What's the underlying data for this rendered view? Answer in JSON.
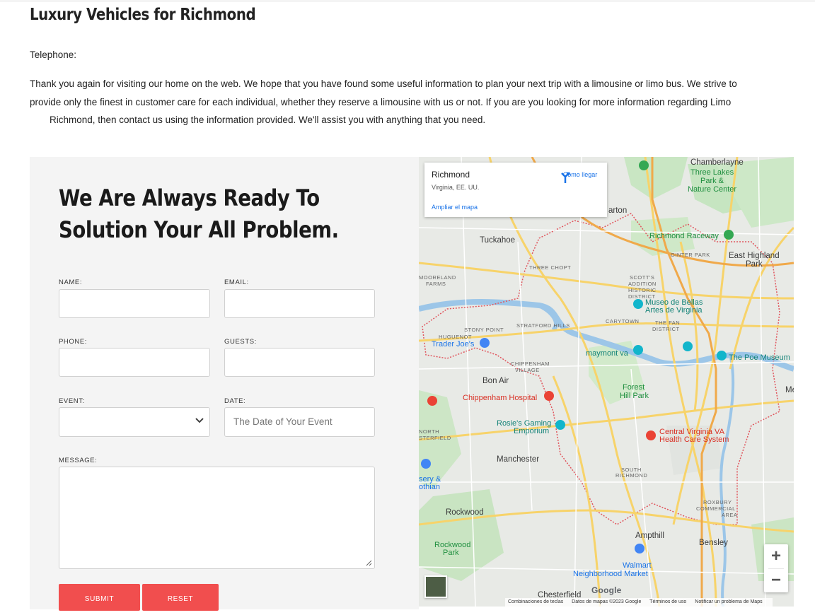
{
  "page": {
    "title": "Luxury Vehicles for Richmond",
    "telephone_label": "Telephone:",
    "intro_line1": "Thank you again for visiting our home on the web. We hope that you have found some useful information to plan your next trip with a limousine or limo bus. We strive to",
    "intro_line2": "provide only the finest in customer care for each individual, whether they reserve a limousine with us or not. If you are you looking for more information regarding Limo",
    "intro_line3": "Richmond, then contact us using the information provided. We'll assist you with anything that you need."
  },
  "form": {
    "heading_line1": "We Are Always Ready To",
    "heading_line2": "Solution Your All Problem.",
    "name_label": "NAME:",
    "email_label": "EMAIL:",
    "phone_label": "PHONE:",
    "guests_label": "GUESTS:",
    "event_label": "EVENT:",
    "event_value": "",
    "date_label": "DATE:",
    "date_placeholder": "The Date of Your Event",
    "message_label": "MESSAGE:",
    "submit_label": "SUBMIT",
    "reset_label": "RESET",
    "submit_color": "#f14e4e"
  },
  "map": {
    "info_title": "Richmond",
    "info_subtitle": "Virginia, EE. UU.",
    "directions_label": "Cómo llegar",
    "enlarge_label": "Ampliar el mapa",
    "zoom_in": "+",
    "zoom_out": "−",
    "google_logo": "Google",
    "attr_keyboard": "Combinaciones de teclas",
    "attr_data": "Datos de mapas ©2023 Google",
    "attr_terms": "Términos de uso",
    "attr_report": "Notificar un problema de Maps",
    "places": {
      "chamberlayne": "Chamberlayne",
      "three_lakes": "Three Lakes",
      "park_and": "Park &",
      "nature_center": "Nature Center",
      "barton": "arton",
      "tuckahoe": "Tuckahoe",
      "raceway": "Richmond Raceway",
      "ginter": "GINTER PARK",
      "east_highland": "East Highland",
      "park": "Park",
      "three_chopt": "THREE CHOPT",
      "mooreland": "MOORELAND",
      "farms": "FARMS",
      "scotts": "SCOTT'S",
      "addition": "ADDITION",
      "historic": "HISTORIC",
      "district": "DISTRICT",
      "museo1": "Museo de Bellas",
      "museo2": "Artes de Virginia",
      "stratford": "STRATFORD HILLS",
      "carytown": "CARYTOWN",
      "fan1": "THE FAN",
      "fan2": "DISTRICT",
      "stony": "STONY POINT",
      "huguenot": "HUGUENOT",
      "traderjoes": "Trader Joe's",
      "maymont": "maymont va",
      "poe": "The Poe Museum",
      "chip1": "CHIPPENHAM",
      "chip2": "VILLAGE",
      "bonair": "Bon Air",
      "chiphosp": "Chippenham Hospital",
      "forest1": "Forest",
      "forest2": "Hill Park",
      "me": "Me",
      "rosies1": "Rosie's Gaming",
      "rosies2": "Emporium",
      "north": "NORTH",
      "sterfield": "STERFIELD",
      "cva1": "Central Virginia VA",
      "cva2": "Health Care System",
      "manchester": "Manchester",
      "sery1": "sery &",
      "sery2": "othian",
      "southrich1": "SOUTH",
      "southrich2": "RICHMOND",
      "rockwood": "Rockwood",
      "commercial1": "COMMERCIAL",
      "commercial2": "AREA",
      "roxbury": "ROXBURY",
      "rockwoodpark1": "Rockwood",
      "rockwoodpark2": "Park",
      "ampthill": "Ampthill",
      "bensley": "Bensley",
      "walmart1": "Walmart",
      "walmart2": "Neighborhood Market",
      "chesterfield": "Chesterfield"
    }
  }
}
